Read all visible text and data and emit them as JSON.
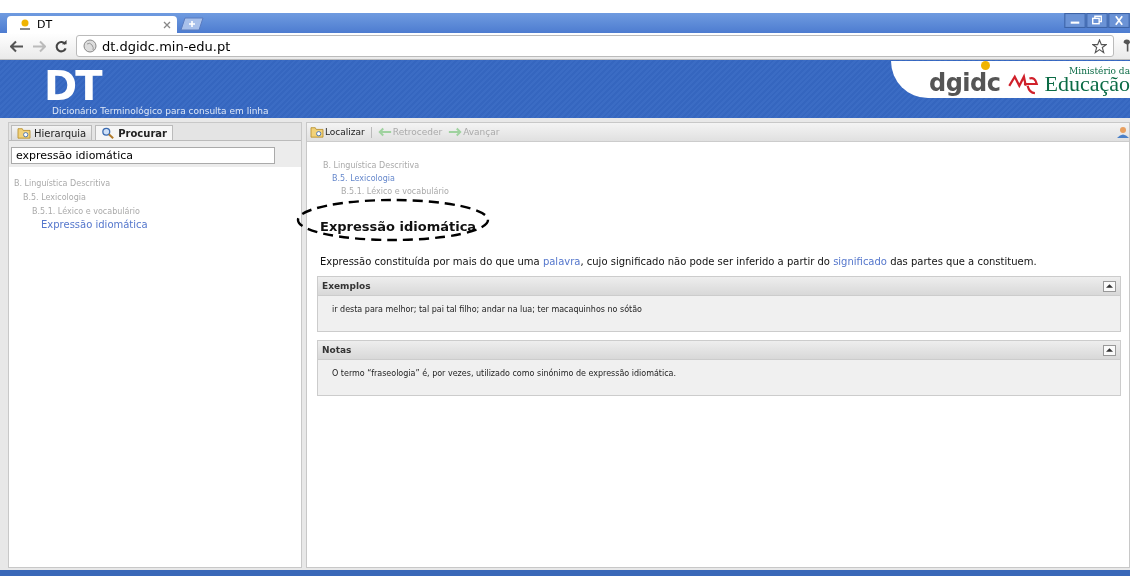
{
  "browser": {
    "tab": {
      "title": "DT"
    },
    "address": "dt.dgidc.min-edu.pt"
  },
  "header": {
    "logo": "DT",
    "subtitle": "Dicionário Terminológico para consulta em linha",
    "brand": "dgidc",
    "ministry_small": "Ministério da",
    "ministry_big": "Educação"
  },
  "left_tabs": [
    {
      "label": "Hierarquia",
      "selected": false
    },
    {
      "label": "Procurar",
      "selected": true
    }
  ],
  "search": {
    "value": "expressão idiomática"
  },
  "tree": [
    {
      "label": "B. Linguística Descritiva",
      "selected": false,
      "children": [
        {
          "label": "B.5. Lexicologia",
          "selected": false,
          "children": [
            {
              "label": "B.5.1. Léxico e vocabulário",
              "selected": false,
              "children": [
                {
                  "label": "Expressão idiomática",
                  "selected": true
                }
              ]
            }
          ]
        }
      ]
    }
  ],
  "toolbar": [
    {
      "label": "Localizar",
      "disabled": false,
      "kind": "locate"
    },
    {
      "label": "Retroceder",
      "disabled": true,
      "kind": "back"
    },
    {
      "label": "Avançar",
      "disabled": true,
      "kind": "forward"
    }
  ],
  "breadcrumb": [
    {
      "label": "B. Linguística Descritiva",
      "link": false
    },
    {
      "label": "B.5. Lexicologia",
      "link": true
    },
    {
      "label": "B.5.1. Léxico e vocabulário",
      "link": false
    }
  ],
  "term": "Expressão idiomática",
  "definition": [
    {
      "text": "Expressão constituída por mais do que uma ",
      "link": false
    },
    {
      "text": "palavra",
      "link": true
    },
    {
      "text": ", cujo significado não pode ser inferido a partir do ",
      "link": false
    },
    {
      "text": "significado",
      "link": true
    },
    {
      "text": " das partes que a constituem.",
      "link": false
    }
  ],
  "sections": [
    {
      "title": "Exemplos",
      "body": "ir desta para melhor; tal pai tal filho; andar na lua; ter macaquinhos no sótão",
      "expanded": true
    },
    {
      "title": "Notas",
      "body": "O termo “fraseologia” é, por vezes, utilizado como sinónimo de expressão idiomática.",
      "expanded": true
    }
  ]
}
